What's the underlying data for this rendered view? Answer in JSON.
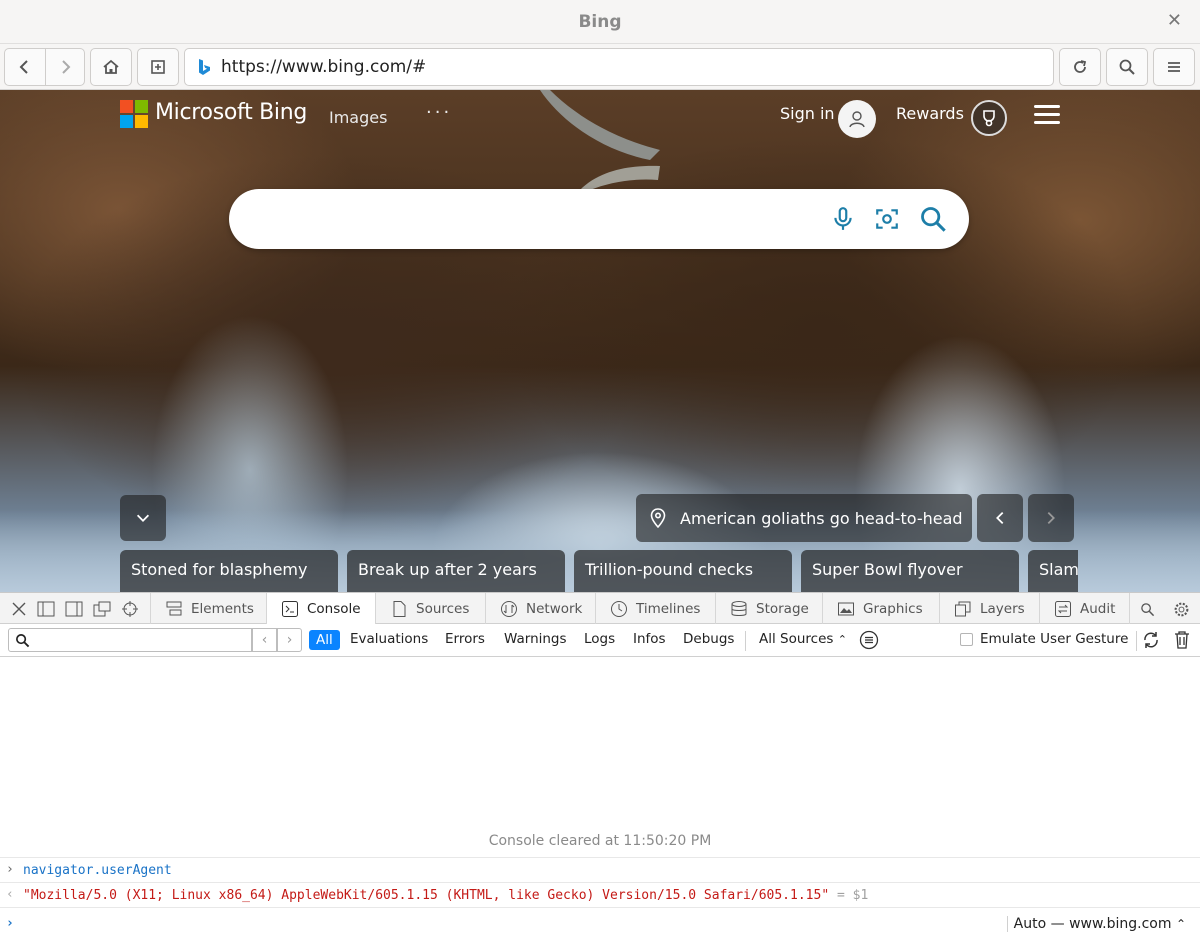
{
  "window": {
    "title": "Bing"
  },
  "toolbar": {
    "url": "https://www.bing.com/#"
  },
  "bing": {
    "brand": "Microsoft Bing",
    "nav_images": "Images",
    "nav_more": "···",
    "sign_in": "Sign in",
    "rewards": "Rewards",
    "search_value": "",
    "caption": "American goliaths go head-to-head",
    "trending": [
      "Stoned for blasphemy",
      "Break up after 2 years",
      "Trillion-pound checks",
      "Super Bowl flyover",
      "Slam"
    ],
    "colors": {
      "ms_red": "#f25022",
      "ms_green": "#7fba00",
      "ms_blue": "#00a4ef",
      "ms_yellow": "#ffb900",
      "search_icon": "#1d7ea8"
    }
  },
  "devtools": {
    "tabs": [
      "Elements",
      "Console",
      "Sources",
      "Network",
      "Timelines",
      "Storage",
      "Graphics",
      "Layers",
      "Audit"
    ],
    "active_tab": "Console",
    "filter_levels": [
      "All",
      "Evaluations",
      "Errors",
      "Warnings",
      "Logs",
      "Infos",
      "Debugs"
    ],
    "sources": "All Sources",
    "emulate": "Emulate User Gesture",
    "cleared": "Console cleared at 11:50:20 PM",
    "command": "navigator.userAgent",
    "result": "\"Mozilla/5.0 (X11; Linux x86_64) AppleWebKit/605.1.15 (KHTML, like Gecko) Version/15.0 Safari/605.1.15\"",
    "result_ref": "= $1",
    "context": "Auto — www.bing.com"
  }
}
